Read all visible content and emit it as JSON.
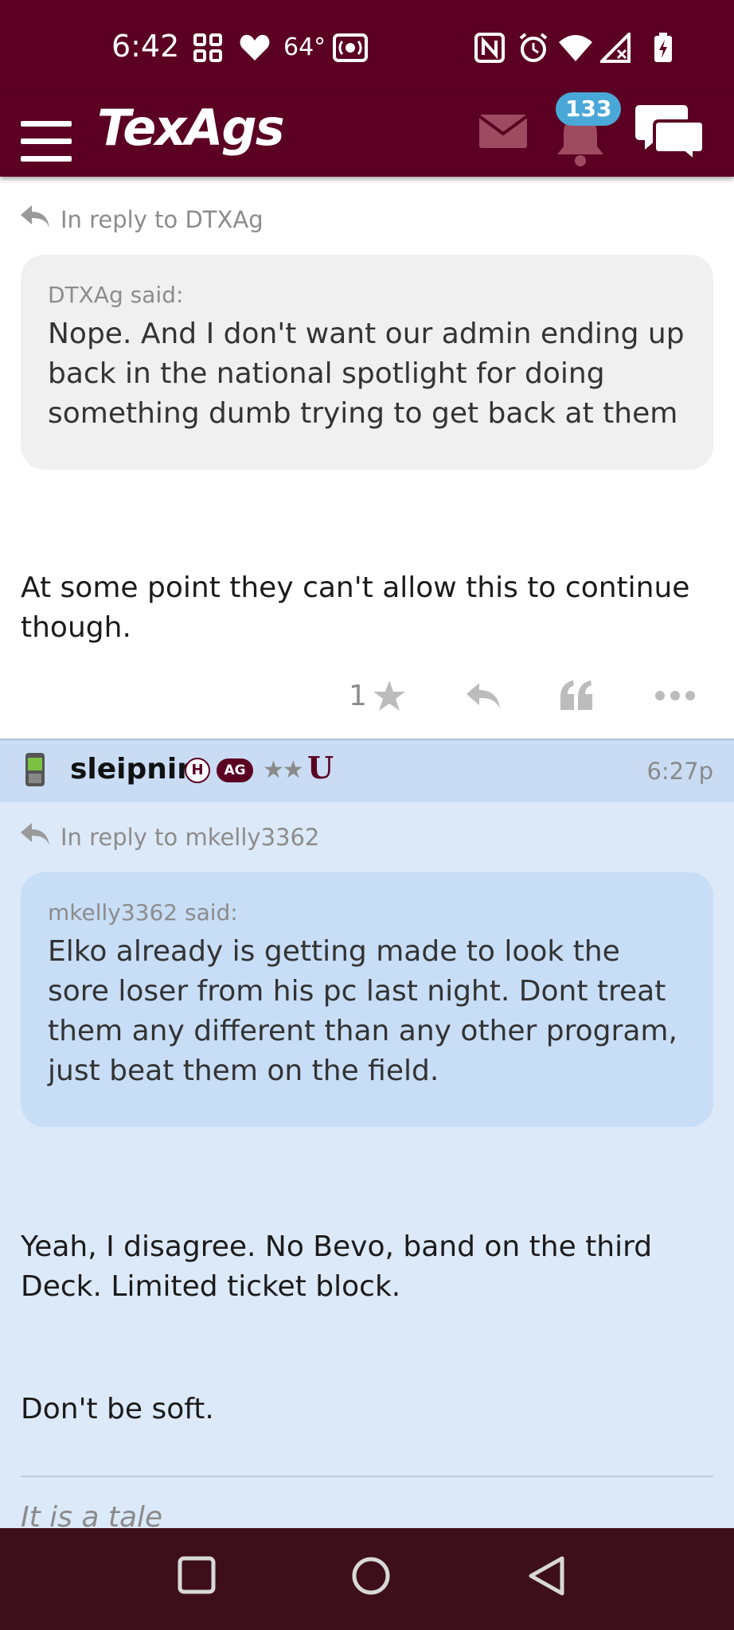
{
  "status_bar": {
    "time": "6:42",
    "temperature": "64°",
    "icons": [
      "grid-icon",
      "heart-icon",
      "hotspot-icon",
      "nfc-icon",
      "alarm-icon",
      "wifi-icon",
      "signal-icon",
      "battery-icon"
    ]
  },
  "header": {
    "logo": "TexAgs",
    "notifications_count": "133"
  },
  "posts": [
    {
      "reply_to": "In reply to DTXAg",
      "quote_author": "DTXAg said:",
      "quote_text": "Nope. And I don't want our admin ending up back in the national spotlight for doing something dumb trying to get back at them",
      "body": "At some point they can't allow this to continue though.",
      "likes": "1"
    },
    {
      "username": "sleipnir",
      "badge_h": "H",
      "badge_ag": "AG",
      "rank_stars": "★★",
      "logo_letter": "U",
      "time": "6:27p",
      "reply_to": "In reply to mkelly3362",
      "quote_author": "mkelly3362 said:",
      "quote_text": "Elko already is getting made to look the sore loser from his pc last night. Dont treat them any different than any other program, just beat them on the field.",
      "body_paragraphs": [
        "Yeah, I disagree. No Bevo, band on the third Deck. Limited ticket block.",
        "Don't be soft."
      ],
      "signature": "It is a tale"
    }
  ],
  "colors": {
    "maroon": "#5b0023",
    "badge_blue": "#4aa8d8",
    "post_blue": "#dce9f8"
  }
}
